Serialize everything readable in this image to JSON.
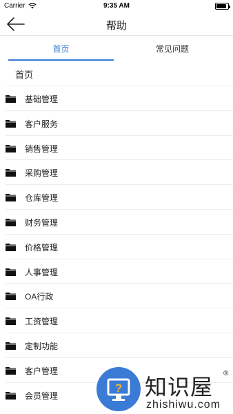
{
  "status_bar": {
    "carrier": "Carrier",
    "time": "9:35 AM",
    "battery_level": 0.9,
    "icons": [
      "wifi-icon",
      "battery-icon"
    ]
  },
  "nav": {
    "title": "帮助",
    "back_icon": "arrow-left-icon"
  },
  "tabs": [
    {
      "label": "首页",
      "active": true
    },
    {
      "label": "常见问题",
      "active": false
    }
  ],
  "breadcrumb": "首页",
  "items": [
    {
      "label": "基础管理",
      "icon": "folder-icon"
    },
    {
      "label": "客户服务",
      "icon": "folder-icon"
    },
    {
      "label": "销售管理",
      "icon": "folder-icon"
    },
    {
      "label": "采购管理",
      "icon": "folder-icon"
    },
    {
      "label": "仓库管理",
      "icon": "folder-icon"
    },
    {
      "label": "财务管理",
      "icon": "folder-icon"
    },
    {
      "label": "价格管理",
      "icon": "folder-icon"
    },
    {
      "label": "人事管理",
      "icon": "folder-icon"
    },
    {
      "label": "OA行政",
      "icon": "folder-icon"
    },
    {
      "label": "工资管理",
      "icon": "folder-icon"
    },
    {
      "label": "定制功能",
      "icon": "folder-icon"
    },
    {
      "label": "客户管理",
      "icon": "folder-icon"
    },
    {
      "label": "会员管理",
      "icon": "folder-icon"
    }
  ],
  "watermark": {
    "name": "知识屋",
    "url": "zhishiwu.com",
    "registered": "®"
  },
  "colors": {
    "accent": "#3a7bd5",
    "text": "#222222",
    "divider": "#ececec"
  }
}
